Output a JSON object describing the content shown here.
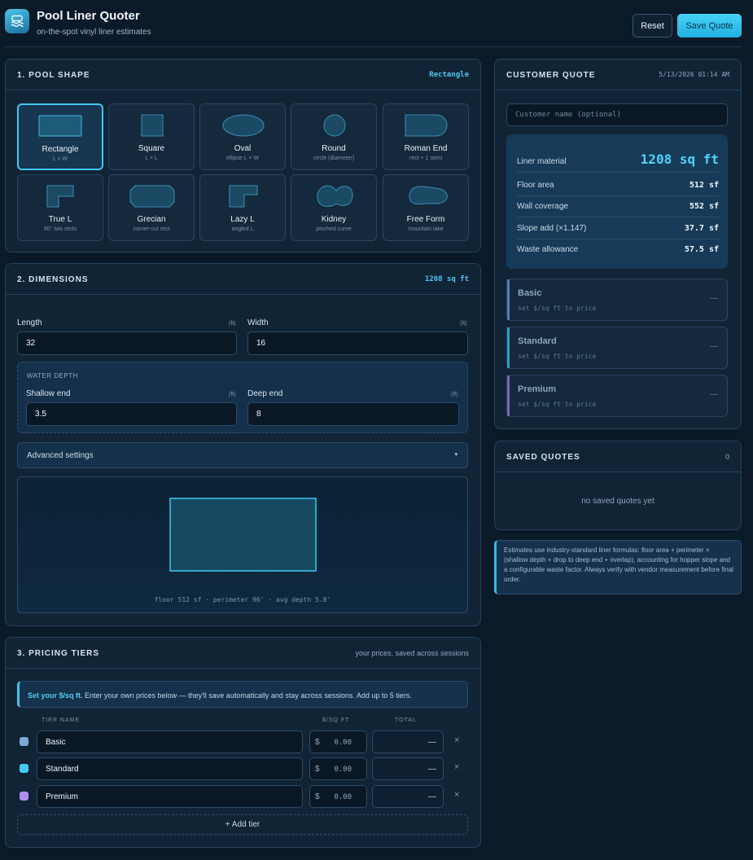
{
  "header": {
    "title": "Pool Liner Quoter",
    "subtitle": "on-the-spot vinyl liner estimates",
    "reset_label": "Reset",
    "save_label": "Save Quote"
  },
  "shape_panel": {
    "title": "1. POOL SHAPE",
    "selected_label": "Rectangle",
    "shapes": [
      {
        "label": "Rectangle",
        "hint": "L × W",
        "icon": "rectangle-shape-icon"
      },
      {
        "label": "Square",
        "hint": "L × L",
        "icon": "square-shape-icon"
      },
      {
        "label": "Oval",
        "hint": "ellipse L × W",
        "icon": "oval-shape-icon"
      },
      {
        "label": "Round",
        "hint": "circle (diameter)",
        "icon": "round-shape-icon"
      },
      {
        "label": "Roman End",
        "hint": "rect + 1 semi",
        "icon": "roman-end-shape-icon"
      },
      {
        "label": "True L",
        "hint": "90° two rects",
        "icon": "true-l-shape-icon"
      },
      {
        "label": "Grecian",
        "hint": "corner-cut rect",
        "icon": "grecian-shape-icon"
      },
      {
        "label": "Lazy L",
        "hint": "angled L",
        "icon": "lazy-l-shape-icon"
      },
      {
        "label": "Kidney",
        "hint": "pinched curve",
        "icon": "kidney-shape-icon"
      },
      {
        "label": "Free Form",
        "hint": "mountain lake",
        "icon": "free-form-shape-icon"
      }
    ]
  },
  "dimensions_panel": {
    "title": "2. DIMENSIONS",
    "total_label": "1208 sq ft",
    "length": {
      "label": "Length",
      "unit": "(ft)",
      "value": "32"
    },
    "width": {
      "label": "Width",
      "unit": "(ft)",
      "value": "16"
    },
    "water_depth": {
      "title": "WATER DEPTH",
      "shallow": {
        "label": "Shallow end",
        "unit": "(ft)",
        "value": "3.5"
      },
      "deep": {
        "label": "Deep end",
        "unit": "(ft)",
        "value": "8"
      }
    },
    "advanced_label": "Advanced settings",
    "advanced_caret": "▾",
    "preview_caption": "floor 512 sf · perimeter 96' · avg depth 5.8'"
  },
  "pricing_panel": {
    "title": "3. PRICING TIERS",
    "right_note": "your prices, saved across sessions",
    "callout_bold": "Set your $/sq ft.",
    "callout_text": " Enter your own prices below — they'll save automatically and stay across sessions. Add up to 5 tiers.",
    "col_name": "TIER NAME",
    "col_price": "$/SQ FT",
    "col_total": "TOTAL",
    "tiers": [
      {
        "name": "Basic",
        "currency": "$",
        "price": "0.00",
        "total": "—",
        "remove": "×",
        "color": "#7fa9d6"
      },
      {
        "name": "Standard",
        "currency": "$",
        "price": "0.00",
        "total": "—",
        "remove": "×",
        "color": "#3fcdf0"
      },
      {
        "name": "Premium",
        "currency": "$",
        "price": "0.00",
        "total": "—",
        "remove": "×",
        "color": "#b08ef0"
      }
    ],
    "add_label": "+ Add tier"
  },
  "quote_panel": {
    "title": "CUSTOMER QUOTE",
    "timestamp": "5/13/2026 01:14 AM",
    "customer_placeholder": "Customer name (optional)",
    "liner_label": "Liner material",
    "liner_value": "1208 sq ft",
    "rows": [
      {
        "label": "Floor area",
        "value": "512 sf"
      },
      {
        "label": "Wall coverage",
        "value": "552 sf"
      },
      {
        "label": "Slope add (×1.147)",
        "value": "37.7 sf"
      },
      {
        "label": "Waste allowance",
        "value": "57.5 sf"
      }
    ],
    "tiers": [
      {
        "name": "Basic",
        "hint": "set $/sq ft to price",
        "value": "—",
        "color": "#4f7fae"
      },
      {
        "name": "Standard",
        "hint": "set $/sq ft to price",
        "value": "—",
        "color": "#2d9cc4"
      },
      {
        "name": "Premium",
        "hint": "set $/sq ft to price",
        "value": "—",
        "color": "#7b63b8"
      }
    ]
  },
  "saved_panel": {
    "title": "SAVED QUOTES",
    "count": "0",
    "empty_text": "no saved quotes yet"
  },
  "note": "Estimates use industry-standard liner formulas: floor area + perimeter × (shallow depth + drop to deep end + overlap), accounting for hopper slope and a configurable waste factor. Always verify with vendor measurement before final order."
}
